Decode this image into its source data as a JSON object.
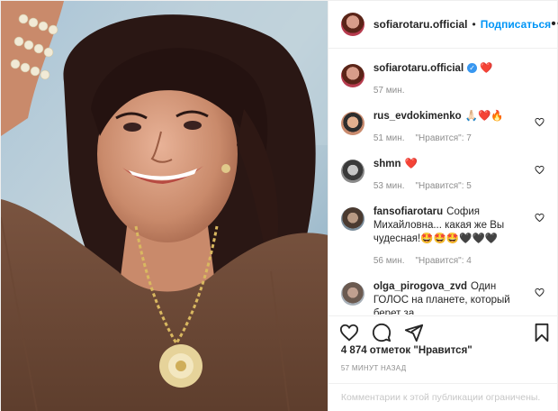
{
  "post": {
    "image_alt": "photo",
    "owner": {
      "username": "sofiarotaru.official",
      "separator": "•",
      "follow_label": "Подписаться",
      "more_label": "•••"
    },
    "caption": {
      "username": "sofiarotaru.official",
      "verified_mark": "✓",
      "text": "❤️",
      "time": "57 мин."
    },
    "comments": [
      {
        "username": "rus_evdokimenko",
        "text": "🙏🏻❤️🔥",
        "time": "51 мин.",
        "likes": "\"Нравится\": 7",
        "avatar": "av2"
      },
      {
        "username": "shmn",
        "text": "❤️",
        "time": "53 мин.",
        "likes": "\"Нравится\": 5",
        "avatar": "av3"
      },
      {
        "username": "fansofiarotaru",
        "text": "София Михайловна... какая же Вы чудесная!🤩🤩🤩🖤🖤🖤",
        "time": "56 мин.",
        "likes": "\"Нравится\": 4",
        "avatar": "av4"
      },
      {
        "username": "olga_pirogova_zvd",
        "text": "Один ГОЛОС на планете, который берет за",
        "time": "",
        "likes": "",
        "avatar": "av5"
      }
    ],
    "likes_text": "4 874 отметок \"Нравится\"",
    "timestamp": "57 МИНУТ НАЗАД",
    "comments_disabled": "Комментарии к этой публикации ограничены.",
    "icons": {
      "like": "heart-icon",
      "comment": "comment-icon",
      "share": "share-icon",
      "save": "bookmark-icon"
    },
    "colors": {
      "accent": "#0095f6",
      "heart": "#ed4956",
      "muted": "#8e8e8e",
      "text": "#262626"
    }
  }
}
